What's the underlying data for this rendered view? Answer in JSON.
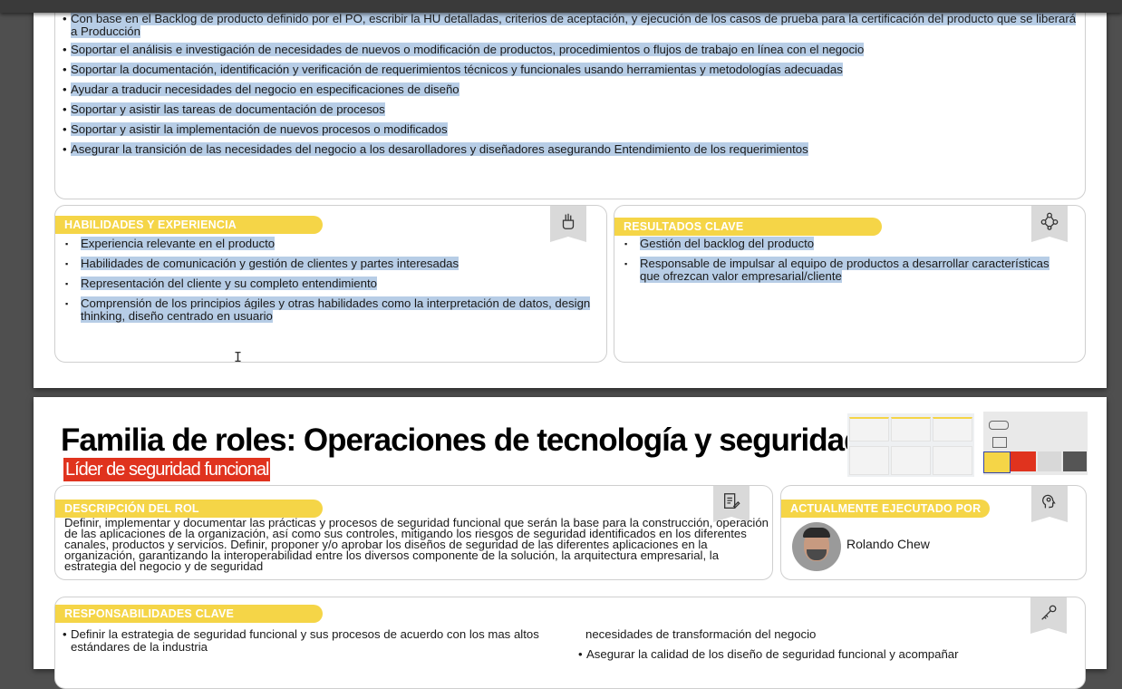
{
  "page1": {
    "responsibilities": [
      "Con base en el Backlog de producto definido por el PO, escribir la HU detalladas, criterios de aceptación, y ejecución de los casos de prueba para la certificación del producto que se liberará a Producción",
      "Soportar el análisis e investigación de necesidades de nuevos o modificación de  productos, procedimientos o flujos de trabajo en línea con el negocio",
      "Soportar la documentación, identificación y verificación de requerimientos técnicos y funcionales usando herramientas y metodologías adecuadas",
      "Ayudar a traducir necesidades del negocio en especificaciones de diseño",
      "Soportar y asistir las tareas de documentación de procesos",
      "Soportar y asistir la implementación de nuevos procesos o modificados",
      "Asegurar la transición de las necesidades del negocio a los desarolladores y diseñadores asegurando Entendimiento de los requerimientos"
    ],
    "skills": {
      "title": "HABILIDADES Y EXPERIENCIA",
      "items": [
        "Experiencia relevante en el producto",
        "Habilidades de comunicación y gestión de clientes y partes interesadas",
        "Representación del cliente y su completo entendimiento",
        "Comprensión de los principios ágiles y otras habilidades como la interpretación de datos, design thinking, diseño centrado en usuario"
      ]
    },
    "results": {
      "title": "RESULTADOS CLAVE",
      "items": [
        "Gestión del backlog del producto",
        "Responsable de impulsar al equipo de productos a desarrollar características que ofrezcan valor empresarial/cliente"
      ]
    }
  },
  "page2": {
    "title": "Familia de roles: Operaciones de tecnología y seguridad",
    "subtitle": "Líder de seguridad funcional",
    "description": {
      "title": "DESCRIPCIÓN DEL ROL",
      "text": "Definir, implementar y documentar las prácticas y procesos de seguridad funcional que serán la base para la construcción, operación de las aplicaciones de la organización, así como sus controles, mitigando los riesgos de seguridad identificados en los diferentes canales, productos y servicios. Definir, proponer y/o aprobar los diseños de seguridad de las diferentes aplicaciones en la organización, garantizando la interoperabilidad entre los diversos componente de la solución, la arquitectura empresarial, la estrategia del negocio y de seguridad"
    },
    "executed_by": {
      "title": "ACTUALMENTE EJECUTADO POR",
      "name": "Rolando Chew"
    },
    "key_resp": {
      "title": "RESPONSABILIDADES CLAVE",
      "left": [
        "Definir la estrategia de seguridad funcional y sus procesos de acuerdo con los mas altos estándares de la industria"
      ],
      "right_cont": "necesidades de transformación del negocio",
      "right": [
        "Asegurar la calidad de los diseño de seguridad funcional y acompañar"
      ]
    }
  },
  "colors": {
    "accent_yellow": "#f5d547",
    "highlight": "#b7cde6",
    "title_red": "#e0331e"
  },
  "icons": [
    "hand-tools-icon",
    "network-nodes-icon",
    "document-pen-icon",
    "head-gears-icon",
    "key-icon"
  ]
}
